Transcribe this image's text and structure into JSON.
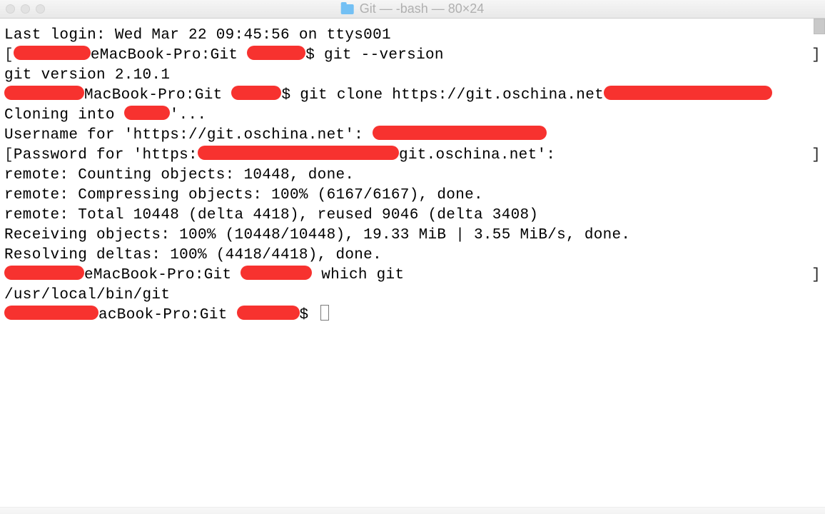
{
  "window": {
    "title": "Git — -bash — 80×24"
  },
  "terminal": {
    "line1": "Last login: Wed Mar 22 09:45:56 on ttys001",
    "line2_a": "eMacBook-Pro:Git ",
    "line2_b": "$ git --version",
    "line3": "git version 2.10.1",
    "line4_a": "MacBook-Pro:Git ",
    "line4_b": "$ git clone https://git.oschina.net",
    "line5_a": "Cloning into ",
    "line5_b": "'...",
    "line6_a": "Username for 'https://git.oschina.net': ",
    "line7_a": "Password for 'https:",
    "line7_b": "git.oschina.net':",
    "line8": "remote: Counting objects: 10448, done.",
    "line9": "remote: Compressing objects: 100% (6167/6167), done.",
    "line10": "remote: Total 10448 (delta 4418), reused 9046 (delta 3408)",
    "line11": "Receiving objects: 100% (10448/10448), 19.33 MiB | 3.55 MiB/s, done.",
    "line12": "Resolving deltas: 100% (4418/4418), done.",
    "line13_a": "eMacBook-Pro:Git ",
    "line13_b": " which git",
    "line14": "/usr/local/bin/git",
    "line15_a": "acBook-Pro:Git ",
    "line15_b": "$ "
  }
}
